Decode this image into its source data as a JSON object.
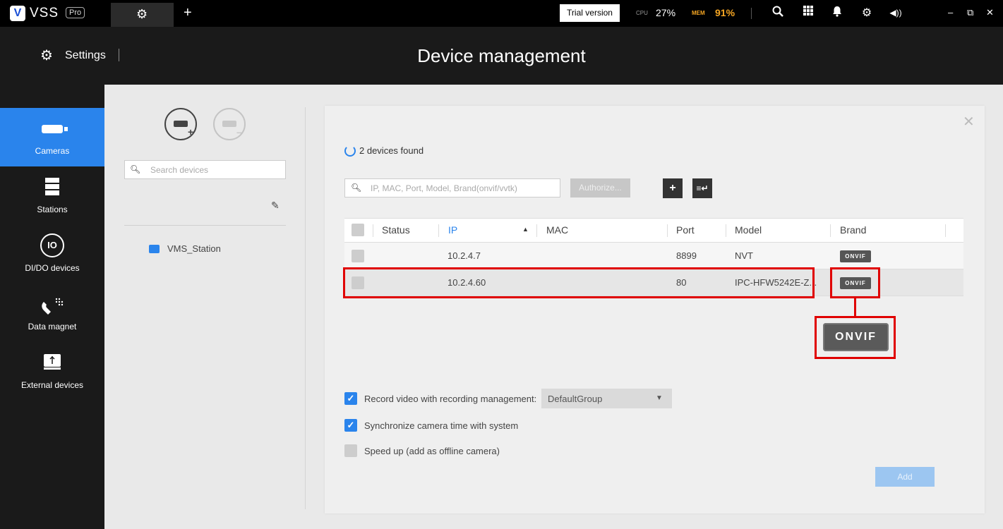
{
  "app": {
    "brand": "VSS",
    "edition": "Pro",
    "trial_label": "Trial version",
    "cpu_label": "CPU",
    "cpu_value": "27%",
    "mem_label": "MEM",
    "mem_value": "91%",
    "accent_color": "#2a84ec",
    "mem_color": "#f5a623"
  },
  "header": {
    "section": "Settings",
    "title": "Device management"
  },
  "sidebar": {
    "items": [
      {
        "label": "Cameras",
        "icon": "camera-icon",
        "active": true
      },
      {
        "label": "Stations",
        "icon": "server-icon"
      },
      {
        "label": "DI/DO devices",
        "icon": "io-icon"
      },
      {
        "label": "Data magnet",
        "icon": "magnet-icon"
      },
      {
        "label": "External devices",
        "icon": "usb-icon"
      }
    ]
  },
  "device_list": {
    "search_placeholder": "Search devices",
    "station": "VMS_Station"
  },
  "dialog": {
    "found_text": "2 devices found",
    "filter_placeholder": "IP, MAC, Port, Model, Brand(onvif/vvtk)",
    "authorize_label": "Authorize...",
    "columns": [
      "Status",
      "IP",
      "MAC",
      "Port",
      "Model",
      "Brand"
    ],
    "rows": [
      {
        "status": "",
        "ip": "10.2.4.7",
        "mac": "",
        "port": "8899",
        "model": "NVT",
        "brand": "ONVIF"
      },
      {
        "status": "",
        "ip": "10.2.4.60",
        "mac": "",
        "port": "80",
        "model": "IPC-HFW5242E-Z...",
        "brand": "ONVIF"
      }
    ],
    "brand_zoom": "ONVIF",
    "record_label": "Record video with recording management:",
    "record_checked": true,
    "record_group": "DefaultGroup",
    "sync_label": "Synchronize camera time with system",
    "sync_checked": true,
    "speed_label": "Speed up (add as offline camera)",
    "speed_checked": false,
    "add_label": "Add"
  }
}
